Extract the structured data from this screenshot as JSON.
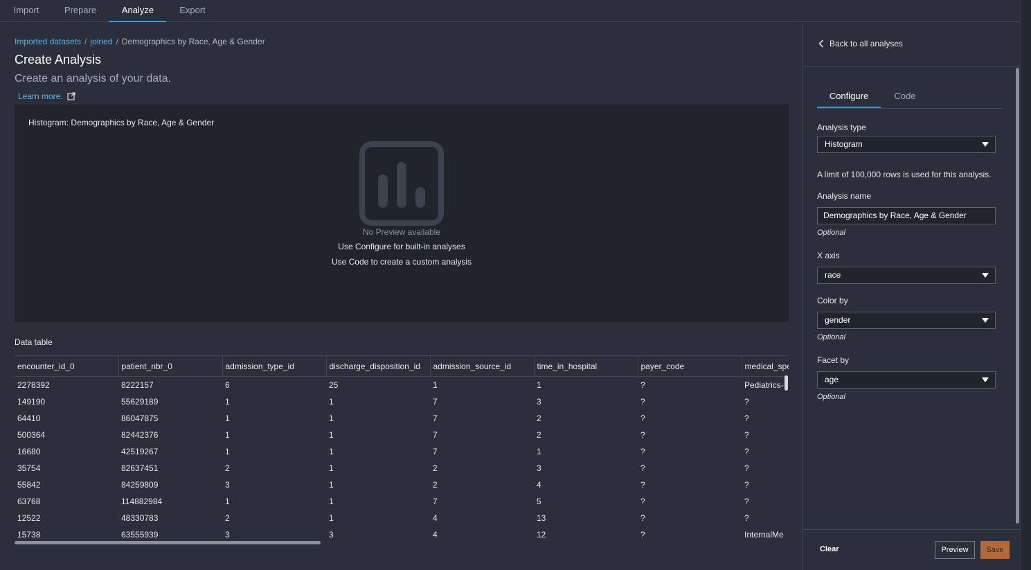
{
  "tabs": [
    {
      "label": "Import",
      "active": false
    },
    {
      "label": "Prepare",
      "active": false
    },
    {
      "label": "Analyze",
      "active": true
    },
    {
      "label": "Export",
      "active": false
    }
  ],
  "breadcrumb": {
    "items": [
      "Imported datasets",
      "joined",
      "Demographics by Race, Age & Gender"
    ],
    "separator": "/"
  },
  "header": {
    "title": "Create Analysis",
    "subtitle": "Create an analysis of your data.",
    "learn_more": "Learn more."
  },
  "preview": {
    "title": "Histogram: Demographics by Race, Age & Gender",
    "no_preview": "No Preview available",
    "hint_configure": "Use Configure for built-in analyses",
    "hint_code": "Use Code to create a custom analysis"
  },
  "data_table": {
    "title": "Data table",
    "columns": [
      "encounter_id_0",
      "patient_nbr_0",
      "admission_type_id",
      "discharge_disposition_id",
      "admission_source_id",
      "time_in_hospital",
      "payer_code",
      "medical_spe"
    ],
    "rows": [
      [
        "2278392",
        "8222157",
        "6",
        "25",
        "1",
        "1",
        "?",
        "Pediatrics-"
      ],
      [
        "149190",
        "55629189",
        "1",
        "1",
        "7",
        "3",
        "?",
        "?"
      ],
      [
        "64410",
        "86047875",
        "1",
        "1",
        "7",
        "2",
        "?",
        "?"
      ],
      [
        "500364",
        "82442376",
        "1",
        "1",
        "7",
        "2",
        "?",
        "?"
      ],
      [
        "16680",
        "42519267",
        "1",
        "1",
        "7",
        "1",
        "?",
        "?"
      ],
      [
        "35754",
        "82637451",
        "2",
        "1",
        "2",
        "3",
        "?",
        "?"
      ],
      [
        "55842",
        "84259809",
        "3",
        "1",
        "2",
        "4",
        "?",
        "?"
      ],
      [
        "63768",
        "114882984",
        "1",
        "1",
        "7",
        "5",
        "?",
        "?"
      ],
      [
        "12522",
        "48330783",
        "2",
        "1",
        "4",
        "13",
        "?",
        "?"
      ],
      [
        "15738",
        "63555939",
        "3",
        "3",
        "4",
        "12",
        "?",
        "InternalMe"
      ]
    ]
  },
  "side_panel": {
    "back_label": "Back to all analyses",
    "tabs": [
      {
        "label": "Configure",
        "active": true
      },
      {
        "label": "Code",
        "active": false
      }
    ],
    "analysis_type_label": "Analysis type",
    "analysis_type_value": "Histogram",
    "limit_note": "A limit of 100,000 rows is used for this analysis.",
    "analysis_name_label": "Analysis name",
    "analysis_name_value": "Demographics by Race, Age & Gender",
    "optional_label": "Optional",
    "x_axis_label": "X axis",
    "x_axis_value": "race",
    "color_by_label": "Color by",
    "color_by_value": "gender",
    "facet_by_label": "Facet by",
    "facet_by_value": "age"
  },
  "footer": {
    "clear": "Clear",
    "preview": "Preview",
    "save": "Save"
  },
  "colors": {
    "background": "#2a2f3b",
    "panel": "#1f242d",
    "accent": "#3f9bd4",
    "link": "#5ab4e8",
    "save_button": "#b26a3c"
  }
}
